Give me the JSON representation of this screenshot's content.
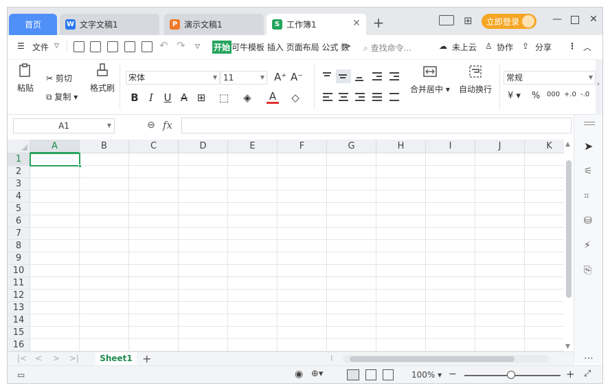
{
  "tabs": [
    {
      "label": "首页",
      "type": "home",
      "active": false
    },
    {
      "label": "文字文稿1",
      "type": "writer",
      "badge": "W",
      "badge_color": "#2b79f0",
      "active": false
    },
    {
      "label": "演示文稿1",
      "type": "presentation",
      "badge": "P",
      "badge_color": "#f07a28",
      "active": false
    },
    {
      "label": "工作簿1",
      "type": "spreadsheet",
      "badge": "S",
      "badge_color": "#24a45c",
      "active": true
    }
  ],
  "titlebar": {
    "new_tab_glyph": "+",
    "login_label": "立即登录",
    "window_controls": [
      "minimize-icon",
      "maximize-icon",
      "close-icon"
    ]
  },
  "menubar": {
    "file_label": "文件",
    "start_label": "开始",
    "menu_items": "可牛模板 插入 页面布局 公式 数",
    "more_arrow": ">",
    "search_placeholder": "查找命令...",
    "cloud_label": "未上云",
    "collab_label": "协作",
    "share_label": "分享"
  },
  "ribbon": {
    "paste_label": "粘贴",
    "cut_label": "剪切",
    "copy_label": "复制",
    "format_painter_label": "格式刷",
    "font_name": "宋体",
    "font_size": "11",
    "bold": "B",
    "italic": "I",
    "underline": "U",
    "strike": "A",
    "font_color_glyph": "A",
    "merge_label": "合并居中",
    "wrap_label": "自动换行",
    "number_format": "常规",
    "currency_glyph": "¥",
    "percent_glyph": "%",
    "thousands_glyph": "000",
    "inc_decimal": "+.0",
    "dec_decimal": "-.0"
  },
  "formulabar": {
    "namebox_value": "A1",
    "fx_label": "fx",
    "formula_value": ""
  },
  "grid": {
    "columns": [
      "A",
      "B",
      "C",
      "D",
      "E",
      "F",
      "G",
      "H",
      "I",
      "J",
      "K"
    ],
    "rows": [
      "1",
      "2",
      "3",
      "4",
      "5",
      "6",
      "7",
      "8",
      "9",
      "10",
      "11",
      "12",
      "13",
      "14",
      "15",
      "16"
    ],
    "active_cell": "A1"
  },
  "sheets": {
    "tabs": [
      "Sheet1"
    ],
    "active": "Sheet1",
    "add_glyph": "+"
  },
  "statusbar": {
    "zoom_label": "100%",
    "zoom_out": "−",
    "zoom_in": "+",
    "zoom_level": 1.0
  },
  "colors": {
    "accent": "#25a35a",
    "home_tab": "#4f8ff7",
    "login": "#f5a623"
  }
}
